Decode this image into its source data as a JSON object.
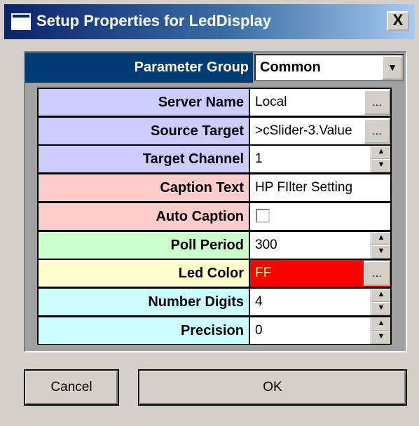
{
  "window": {
    "title": "Setup Properties for LedDisplay",
    "close_label": "X"
  },
  "parameter_group": {
    "label": "Parameter Group",
    "value": "Common",
    "dropdown_glyph": "▼"
  },
  "properties": [
    {
      "label": "Server Name",
      "value": "Local",
      "control": "ellipsis",
      "color": "#ccccff"
    },
    {
      "label": "Source Target",
      "value": ">cSlider-3.Value",
      "control": "ellipsis",
      "color": "#ccccff"
    },
    {
      "label": "Target Channel",
      "value": "1",
      "control": "spinner",
      "color": "#ccccff"
    },
    {
      "label": "Caption Text",
      "value": "HP FIlter Setting",
      "control": "none",
      "color": "#ffcccc"
    },
    {
      "label": "Auto Caption",
      "value": "",
      "control": "checkbox",
      "checked": false,
      "color": "#ffcccc"
    },
    {
      "label": "Poll Period",
      "value": "300",
      "control": "spinner",
      "color": "#ccffcc"
    },
    {
      "label": "Led Color",
      "value": "FF",
      "control": "ellipsis",
      "color": "#ffffcc",
      "value_bg": "#ff0000",
      "value_fg": "#ffff99"
    },
    {
      "label": "Number Digits",
      "value": "4",
      "control": "spinner",
      "color": "#ccffff"
    },
    {
      "label": "Precision",
      "value": "0",
      "control": "spinner",
      "color": "#ccffff"
    }
  ],
  "ellipsis_label": "...",
  "spinner_up": "▲",
  "spinner_down": "▼",
  "buttons": {
    "cancel": "Cancel",
    "ok": "OK"
  }
}
